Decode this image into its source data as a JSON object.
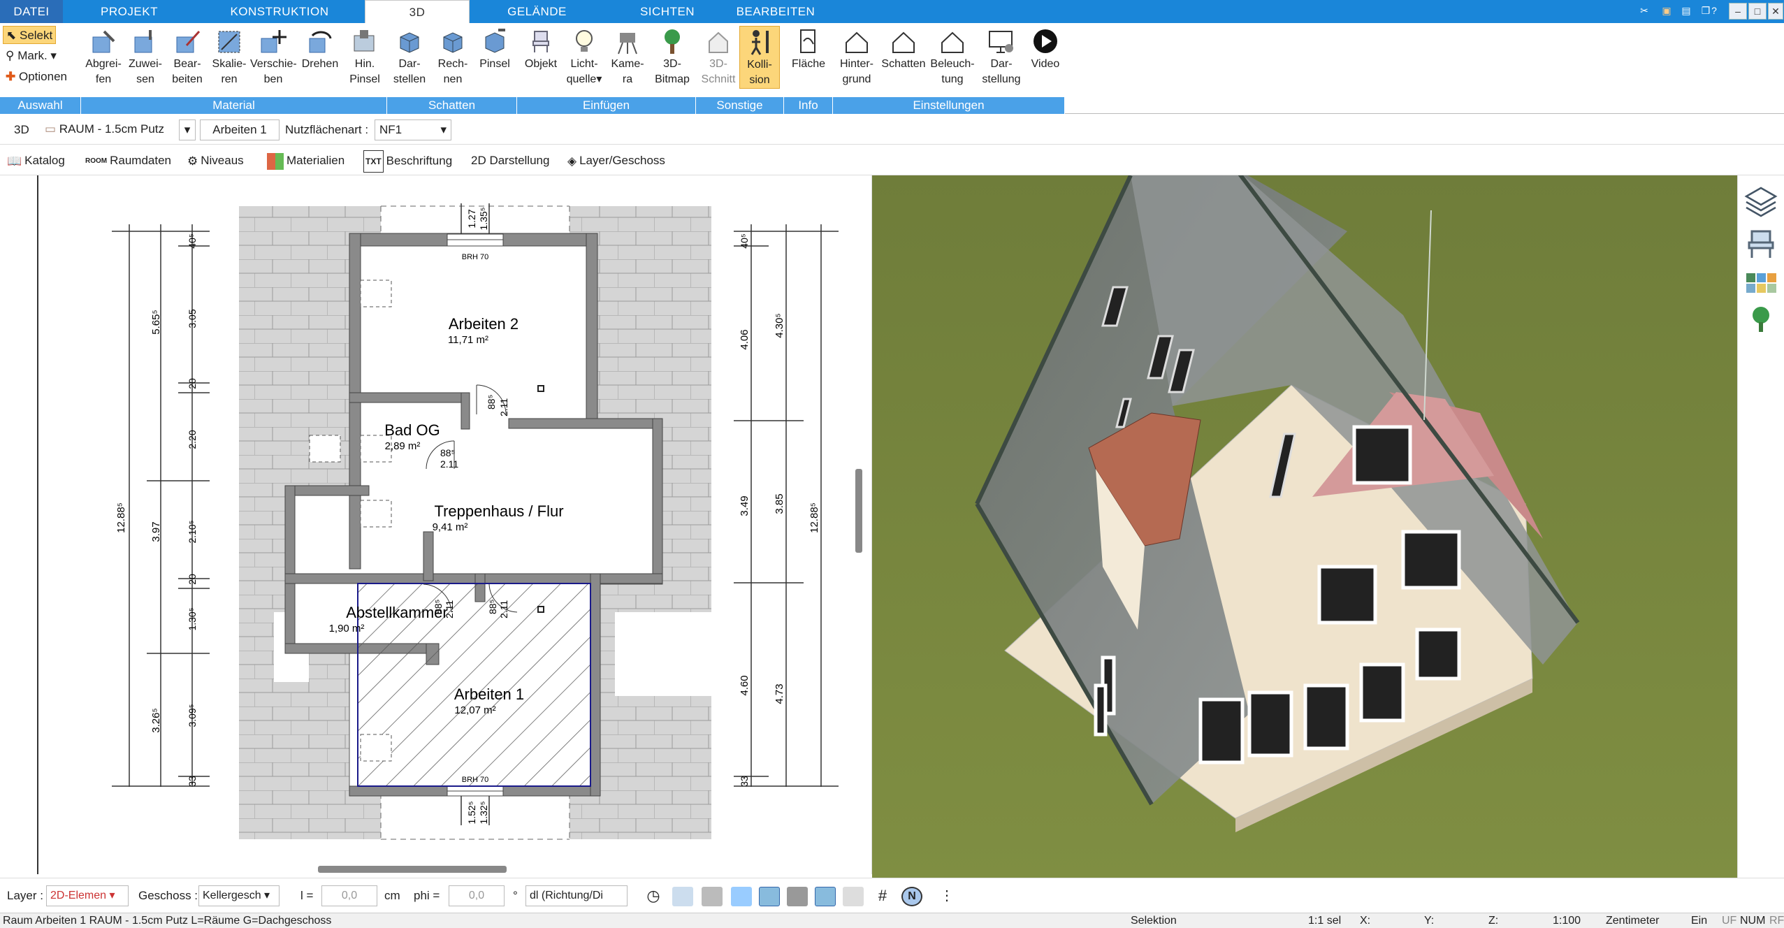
{
  "tabs": [
    "DATEI",
    "PROJEKT",
    "KONSTRUKTION",
    "3D",
    "GELÄNDE",
    "SICHTEN",
    "BEARBEITEN"
  ],
  "ribbon": {
    "side": {
      "select": "Selekt",
      "mark": "Mark.",
      "options": "Optionen"
    },
    "material": {
      "grab1": "Abgrei-",
      "grab2": "fen",
      "assign1": "Zuwei-",
      "assign2": "sen",
      "edit1": "Bear-",
      "edit2": "beiten",
      "scale1": "Skalie-",
      "scale2": "ren",
      "move1": "Verschie-",
      "move2": "ben",
      "rotate": "Drehen",
      "brush1": "Hin.",
      "brush2": "Pinsel"
    },
    "shadow": {
      "show1": "Dar-",
      "show2": "stellen",
      "calc1": "Rech-",
      "calc2": "nen",
      "brush": "Pinsel"
    },
    "insert": {
      "object": "Objekt",
      "light1": "Licht-",
      "light2": "quelle",
      "cam1": "Kame-",
      "cam2": "ra",
      "bitmap1": "3D-",
      "bitmap2": "Bitmap"
    },
    "misc": {
      "cut1": "3D-",
      "cut2": "Schnitt",
      "coll1": "Kolli-",
      "coll2": "sion"
    },
    "info": {
      "area": "Fläche"
    },
    "settings": {
      "bg1": "Hinter-",
      "bg2": "grund",
      "shadows": "Schatten",
      "light1": "Beleuch-",
      "light2": "tung",
      "disp1": "Dar-",
      "disp2": "stellung",
      "video": "Video"
    },
    "groups": {
      "selection": "Auswahl",
      "material": "Material",
      "shadow": "Schatten",
      "insert": "Einfügen",
      "misc": "Sonstige",
      "info": "Info",
      "settings": "Einstellungen"
    }
  },
  "bar2": {
    "mode": "3D",
    "room": "RAUM - 1.5cm Putz",
    "tabname": "Arbeiten 1",
    "usagelabel": "Nutzflächenart :",
    "usage": "NF1"
  },
  "bar3": {
    "catalog": "Katalog",
    "roomdata": "Raumdaten",
    "levels": "Niveaus",
    "materials": "Materialien",
    "labeling": "Beschriftung",
    "view2d": "2D Darstellung",
    "layer": "Layer/Geschoss"
  },
  "plan": {
    "rooms": [
      {
        "name": "Arbeiten 2",
        "area": "11,71 m²"
      },
      {
        "name": "Bad OG",
        "area": "2,89 m²"
      },
      {
        "name": "Treppenhaus / Flur",
        "area": "9,41 m²"
      },
      {
        "name": "Abstellkammer",
        "area": "1,90 m²"
      },
      {
        "name": "Arbeiten 1",
        "area": "12,07 m²"
      }
    ],
    "brh_top": "BRH 70",
    "brh_bottom": "BRH 70",
    "dims_left_outer": [
      "5.65⁵",
      "3.97",
      "3.26⁵"
    ],
    "dims_left_total": "12.88⁵",
    "dims_left_inner": [
      "40⁵",
      "3.05",
      "20",
      "2.20",
      "2.10⁵",
      "20",
      "1.30⁵",
      "3.09⁵",
      "33"
    ],
    "dims_right_inner": [
      "40⁵",
      "4.06",
      "3.49",
      "4.60",
      "33"
    ],
    "dims_right_mid": [
      "4.30⁵",
      "3.85",
      "4.73"
    ],
    "dims_right_total": "12.88⁵",
    "dims_top": [
      "1.27",
      "1.35⁵"
    ],
    "dims_bottom": [
      "1.52⁵",
      "1.32⁵"
    ],
    "doors": [
      {
        "a": "88⁵",
        "b": "2.11"
      },
      {
        "a": "88⁵",
        "b": "2.11"
      },
      {
        "a": "88⁵",
        "b": "2.11"
      },
      {
        "a": "88⁵",
        "b": "2.11"
      }
    ]
  },
  "bottom": {
    "layer_label": "Layer :",
    "layer_val": "2D-Elemen",
    "floor_label": "Geschoss :",
    "floor_val": "Kellergesch",
    "l_label": "l =",
    "l_val": "0,0",
    "unit": "cm",
    "phi_label": "phi =",
    "phi_val": "0,0",
    "deg": "°",
    "dir": "dl (Richtung/Di"
  },
  "status": {
    "text": "Raum Arbeiten 1 RAUM - 1.5cm Putz L=Räume G=Dachgeschoss",
    "mode": "Selektion",
    "sel": "1:1 sel",
    "x": "X:",
    "y": "Y:",
    "z": "Z:",
    "scale": "1:100",
    "unit": "Zentimeter",
    "ein": "Ein",
    "uf": "UF",
    "num": "NUM",
    "rf": "RF"
  },
  "colors": {
    "accent": "#1a86d9",
    "group": "#4aa1e8",
    "grass": "#7a8a3a"
  }
}
